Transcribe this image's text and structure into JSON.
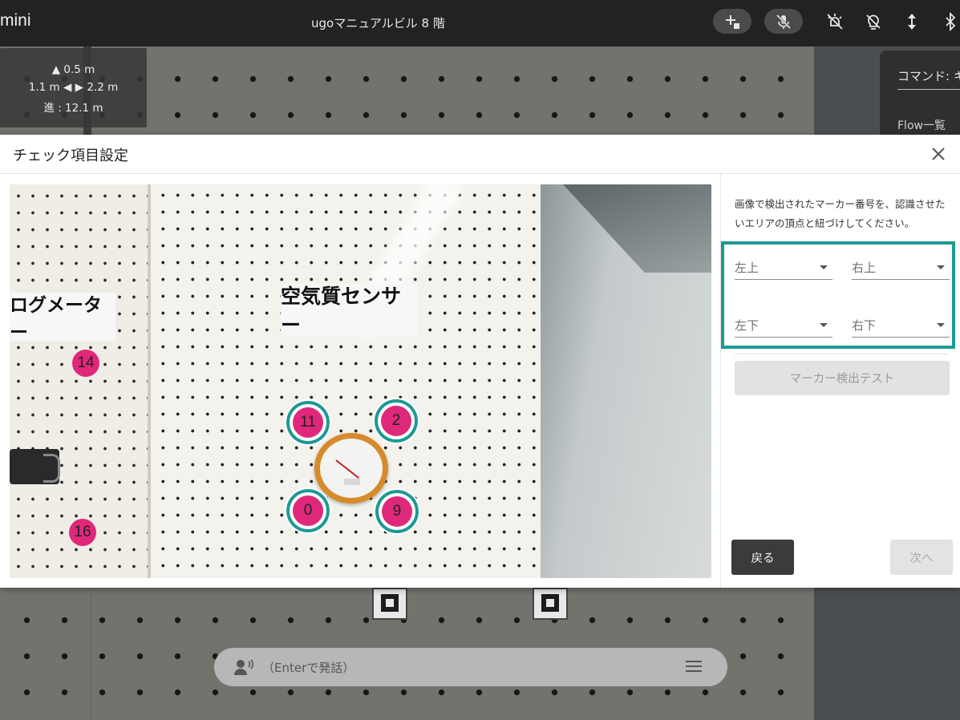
{
  "topbar": {
    "app_title": "mini",
    "page_title": "ugoマニュアルビル 8 階",
    "icons": [
      "add-pin-icon",
      "mic-off-icon",
      "light-off-icon",
      "bulb-off-icon",
      "vertical-arrows-icon",
      "bluetooth-icon"
    ]
  },
  "distance": {
    "up": "▲ 0.5 m",
    "sides": "1.1 m ◀ ▶ 2.2 m",
    "forward": "進 : 12.1 m"
  },
  "command_panel": {
    "command_label": "コマンド: キ",
    "flow_label": "Flow一覧"
  },
  "speech": {
    "placeholder": "（Enterで発話）"
  },
  "dialog": {
    "title": "チェック項目設定",
    "photo": {
      "sign_air": "空気質センサー",
      "sign_analog": "ログメーター",
      "markers": [
        {
          "id": "11",
          "selected": true
        },
        {
          "id": "2",
          "selected": true
        },
        {
          "id": "0",
          "selected": true
        },
        {
          "id": "9",
          "selected": true
        },
        {
          "id": "14",
          "selected": false
        },
        {
          "id": "16",
          "selected": false
        }
      ]
    },
    "side": {
      "instruction": "画像で検出されたマーカー番号を、認識させたいエリアの頂点と紐づけしてください。",
      "corners": {
        "top_left": "左上",
        "top_right": "右上",
        "bottom_left": "左下",
        "bottom_right": "右下"
      },
      "test_button": "マーカー検出テスト",
      "back_button": "戻る",
      "next_button": "次へ"
    }
  },
  "colors": {
    "accent": "#1e9995",
    "marker": "#e0287a",
    "topbar": "#222222"
  }
}
